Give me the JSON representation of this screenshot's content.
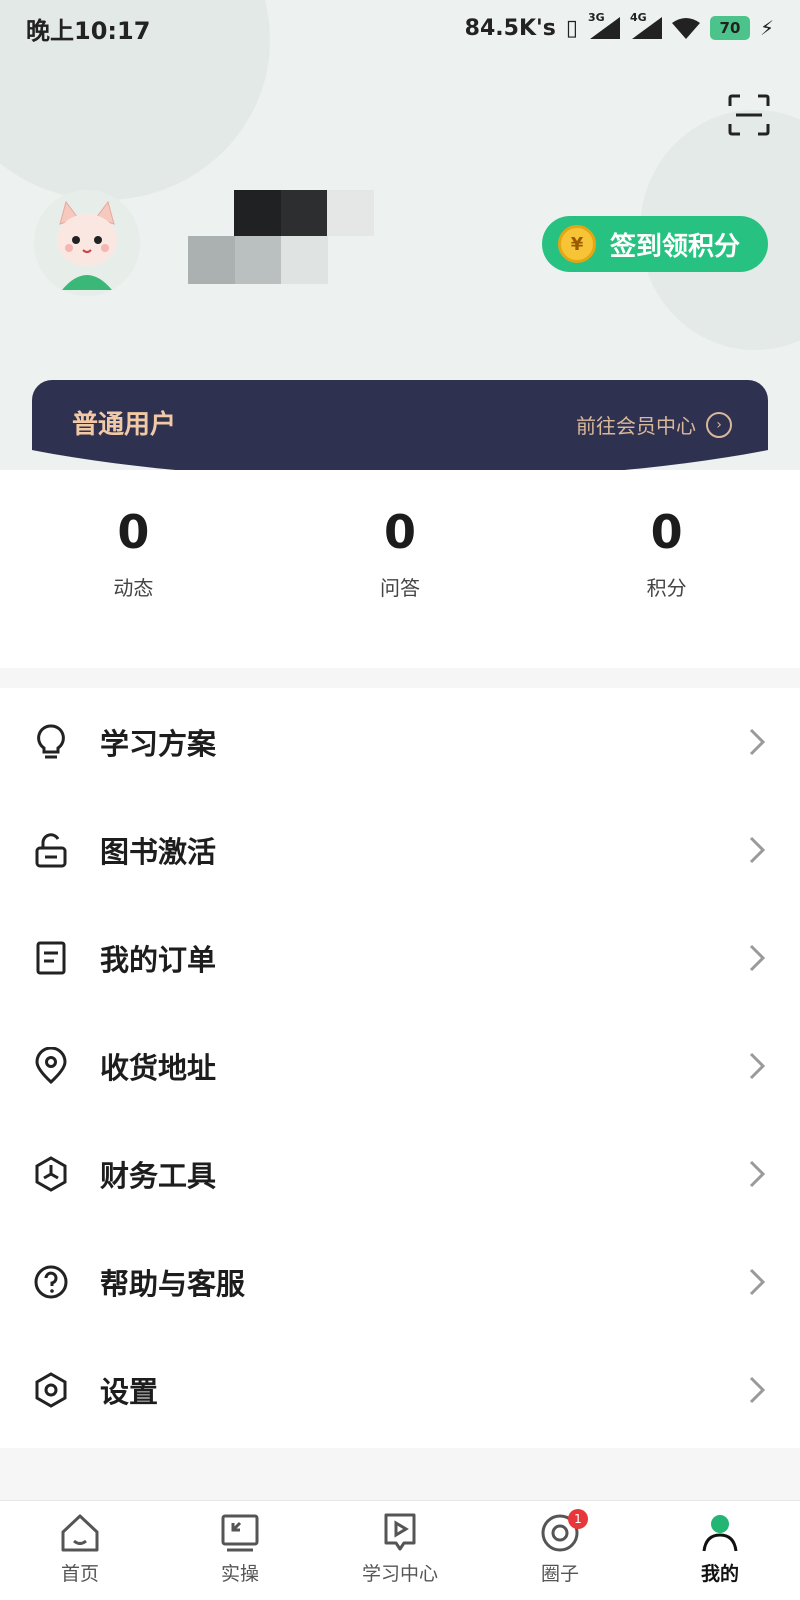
{
  "status_bar": {
    "time": "晚上10:17",
    "network_speed": "84.5K's",
    "signal1_label": "3G",
    "signal2_label": "4G",
    "battery": "70"
  },
  "header": {
    "checkin_label": "签到领积分",
    "coin_symbol": "¥",
    "member_level": "普通用户",
    "member_link": "前往会员中心"
  },
  "stats": [
    {
      "value": "0",
      "label": "动态"
    },
    {
      "value": "0",
      "label": "问答"
    },
    {
      "value": "0",
      "label": "积分"
    }
  ],
  "menu": [
    {
      "label": "学习方案",
      "icon": "lightbulb-icon"
    },
    {
      "label": "图书激活",
      "icon": "unlock-icon"
    },
    {
      "label": "我的订单",
      "icon": "order-document-icon"
    },
    {
      "label": "收货地址",
      "icon": "location-pin-icon"
    },
    {
      "label": "财务工具",
      "icon": "finance-tool-icon"
    },
    {
      "label": "帮助与客服",
      "icon": "help-question-icon"
    },
    {
      "label": "设置",
      "icon": "settings-hexagon-icon"
    }
  ],
  "tabbar": {
    "tabs": [
      {
        "label": "首页",
        "icon": "home-icon"
      },
      {
        "label": "实操",
        "icon": "practice-screen-icon"
      },
      {
        "label": "学习中心",
        "icon": "study-play-icon"
      },
      {
        "label": "圈子",
        "icon": "circle-community-icon"
      },
      {
        "label": "我的",
        "icon": "profile-user-icon"
      }
    ],
    "badge": "1",
    "active": "我的"
  },
  "colors": {
    "accent_green": "#27c281",
    "member_bg": "#2f3150",
    "member_text": "#f1c9a4",
    "badge_red": "#e8373b"
  }
}
